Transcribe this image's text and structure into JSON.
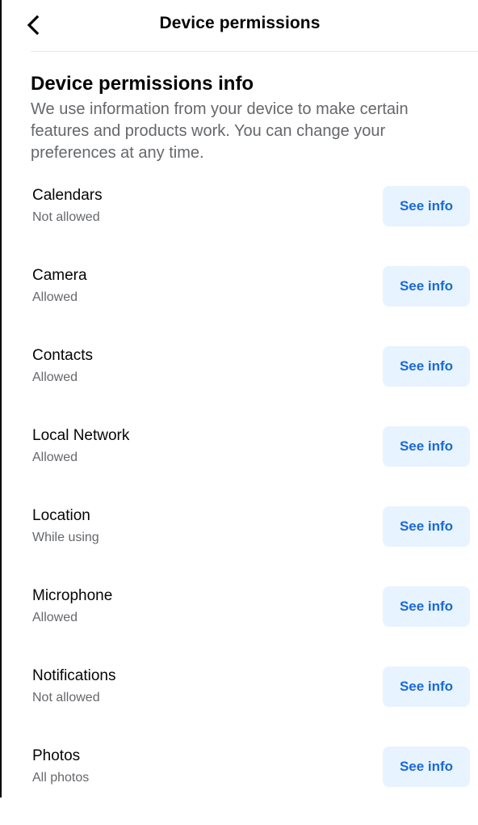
{
  "header": {
    "title": "Device permissions",
    "back_icon": "chevron-left-icon"
  },
  "intro": {
    "heading": "Device permissions info",
    "description": "We use information from your device to make certain features and products work. You can change your preferences at any time."
  },
  "permissions": [
    {
      "name": "Calendars",
      "status": "Not allowed",
      "button": "See info"
    },
    {
      "name": "Camera",
      "status": "Allowed",
      "button": "See info"
    },
    {
      "name": "Contacts",
      "status": "Allowed",
      "button": "See info"
    },
    {
      "name": "Local Network",
      "status": "Allowed",
      "button": "See info"
    },
    {
      "name": "Location",
      "status": "While using",
      "button": "See info"
    },
    {
      "name": "Microphone",
      "status": "Allowed",
      "button": "See info"
    },
    {
      "name": "Notifications",
      "status": "Not allowed",
      "button": "See info"
    },
    {
      "name": "Photos",
      "status": "All photos",
      "button": "See info"
    }
  ],
  "colors": {
    "button_bg": "#e7f3ff",
    "button_text": "#1b69d6",
    "secondary_text": "#65676b"
  }
}
